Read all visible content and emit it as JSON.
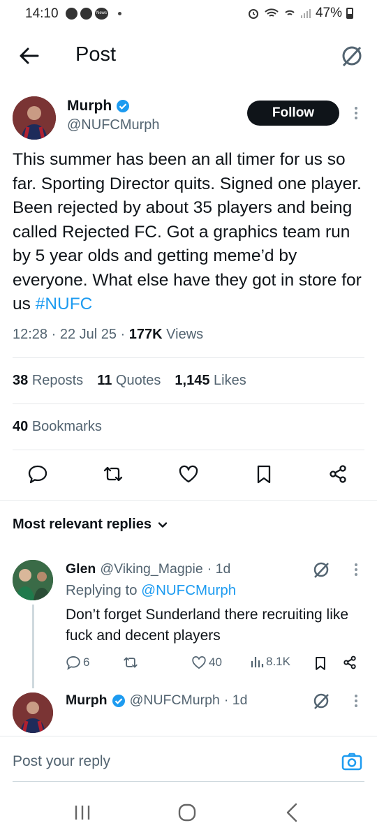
{
  "status_bar": {
    "time": "14:10",
    "news_label": "News",
    "battery": "47%"
  },
  "header": {
    "title": "Post",
    "back_icon": "arrow-left-icon",
    "grok_icon": "grok-icon"
  },
  "post": {
    "author": {
      "name": "Murph",
      "handle": "@NUFCMurph",
      "verified": true
    },
    "follow_label": "Follow",
    "text": "This summer has been an all timer for us so far. Sporting Director quits. Signed one player. Been rejected by about 35 players and being called Rejected FC. Got a graphics team run by 5 year olds and getting meme’d by everyone. What else have they got in store for us ",
    "hashtag": "#NUFC",
    "time": "12:28 · 22 Jul 25 · ",
    "views_count": "177K",
    "views_label": " Views",
    "stats": {
      "reposts_count": "38",
      "reposts_label": "Reposts",
      "quotes_count": "11",
      "quotes_label": "Quotes",
      "likes_count": "1,145",
      "likes_label": "Likes",
      "bookmarks_count": "40",
      "bookmarks_label": "Bookmarks"
    }
  },
  "replies": {
    "sort_label": "Most relevant replies",
    "items": [
      {
        "name": "Glen",
        "handle": "@Viking_Magpie",
        "time": "· 1d",
        "replying_prefix": "Replying to ",
        "replying_to": "@NUFCMurph",
        "text": "Don’t forget Sunderland there recruiting like fuck and decent players",
        "reply_count": "6",
        "like_count": "40",
        "view_count": "8.1K"
      },
      {
        "name": "Murph",
        "handle": "@NUFCMurph",
        "time": "· 1d"
      }
    ]
  },
  "composer": {
    "placeholder": "Post your reply"
  },
  "colors": {
    "accent": "#1d9bf0",
    "text": "#0f1419",
    "muted": "#536471"
  }
}
